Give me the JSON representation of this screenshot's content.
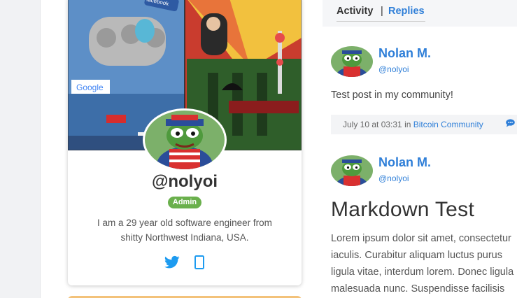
{
  "profile": {
    "handle": "@nolyoi",
    "role_badge": "Admin",
    "bio": "I am a 29 year old software engineer from shitty Northwest Indiana, USA.",
    "banner_words": [
      "facebook",
      "Google"
    ],
    "social_icons": [
      "twitter-icon",
      "github-icon"
    ]
  },
  "tabs": {
    "activity": "Activity",
    "separator": "|",
    "replies": "Replies"
  },
  "posts": [
    {
      "author": "Nolan M.",
      "username": "@nolyoi",
      "body": "Test post in my community!",
      "date": "July 10 at 03:31",
      "in_label": "in",
      "community": "Bitcoin Community",
      "reply_icon": "comment-icon"
    },
    {
      "author": "Nolan M.",
      "username": "@nolyoi",
      "title": "Markdown Test",
      "body_lines": [
        "Lorem ipsum dolor sit amet, consectetur",
        "iaculis. Curabitur aliquam luctus purus",
        "ligula vitae, interdum lorem. Donec ligula",
        "malesuada nunc. Suspendisse facilisis"
      ]
    }
  ],
  "colors": {
    "link": "#2f7fd8",
    "admin_badge": "#6ab04c",
    "twitter": "#1d9bf0",
    "rail": "#f1f2f4"
  }
}
